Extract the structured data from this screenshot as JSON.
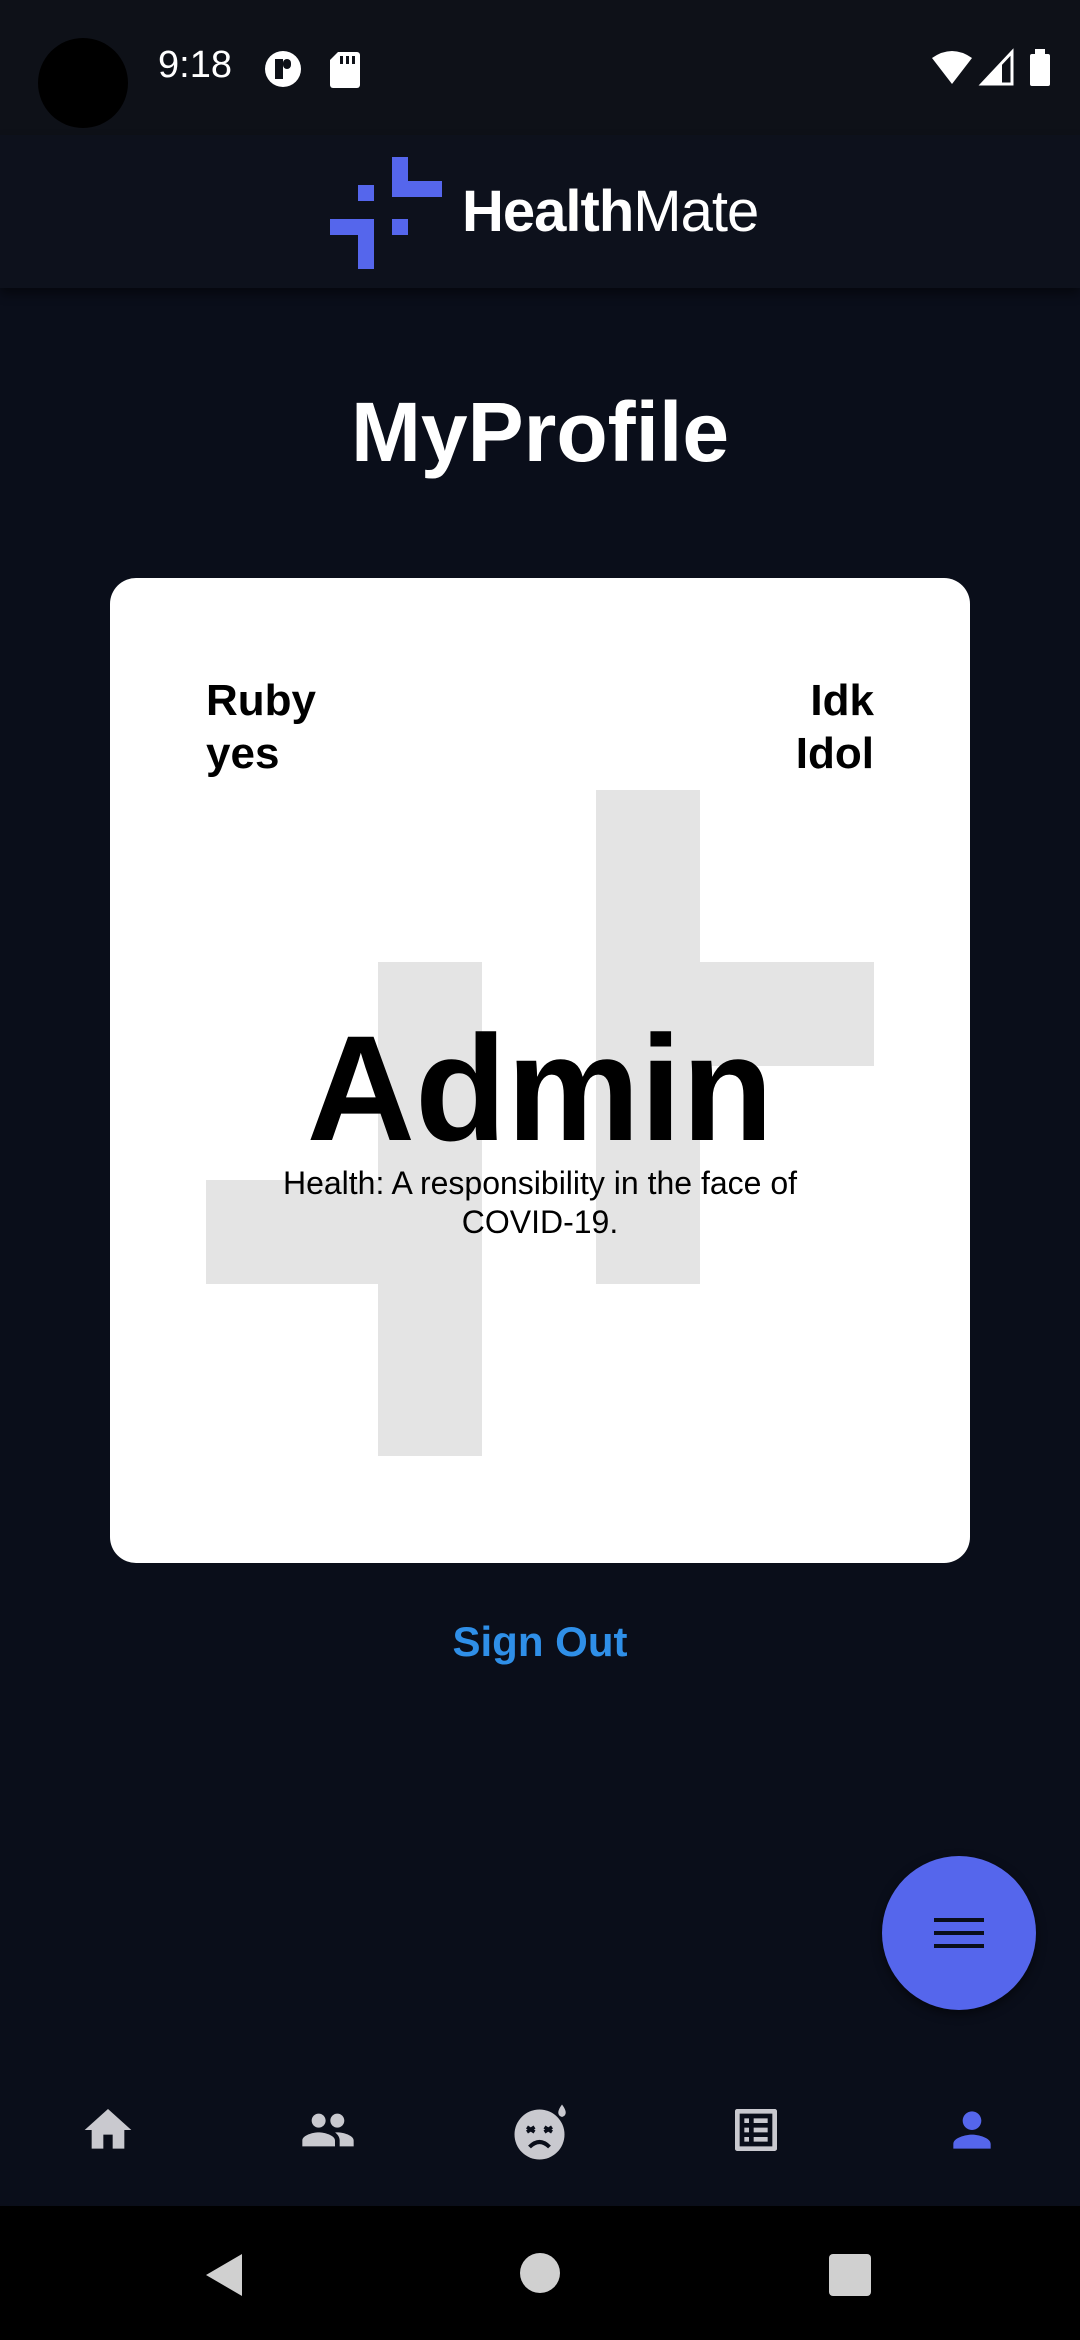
{
  "status_bar": {
    "time": "9:18"
  },
  "header": {
    "brand_part1": "Health",
    "brand_part2": "Mate",
    "accent_color": "#5566ec"
  },
  "page": {
    "title": "MyProfile"
  },
  "profile_card": {
    "first_name": "Ruby",
    "last_name": "yes",
    "top_right_line1": "Idk",
    "top_right_line2": "Idol",
    "role": "Admin",
    "motto": "Health: A responsibility in the face of COVID-19."
  },
  "actions": {
    "sign_out_label": "Sign Out",
    "sign_out_color": "#2f8fe8",
    "fab_icon": "menu-icon"
  },
  "bottom_nav": {
    "items": [
      {
        "icon": "home-icon",
        "active": false
      },
      {
        "icon": "people-icon",
        "active": false
      },
      {
        "icon": "sick-face-icon",
        "active": false
      },
      {
        "icon": "list-icon",
        "active": false
      },
      {
        "icon": "person-icon",
        "active": true
      }
    ],
    "active_color": "#5566ec",
    "inactive_color": "#c9c9cf"
  },
  "system_nav": {
    "items": [
      "back-icon",
      "home-circle-icon",
      "recents-icon"
    ]
  }
}
